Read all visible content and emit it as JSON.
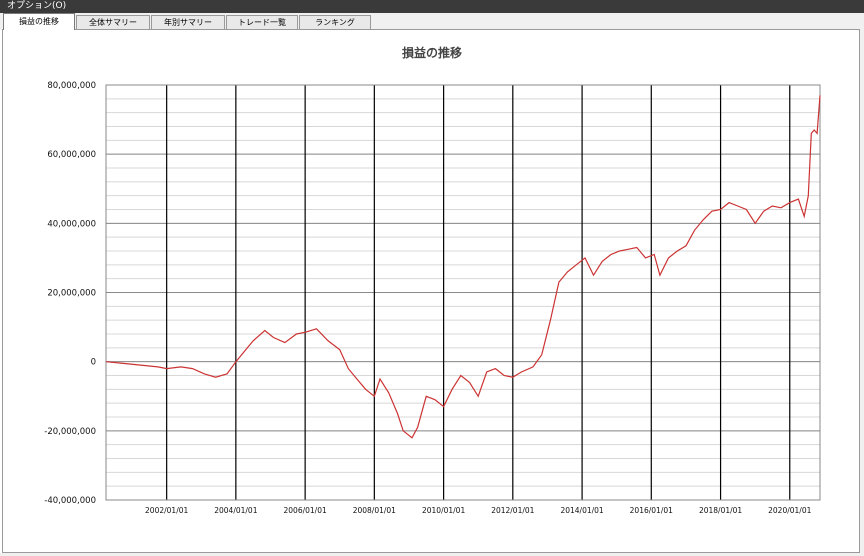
{
  "menu": {
    "options_label": "オプション(O)"
  },
  "tabs": [
    {
      "label": "損益の推移",
      "active": true
    },
    {
      "label": "全体サマリー",
      "active": false
    },
    {
      "label": "年別サマリー",
      "active": false
    },
    {
      "label": "トレード一覧",
      "active": false
    },
    {
      "label": "ランキング",
      "active": false
    }
  ],
  "chart_data": {
    "type": "line",
    "title": "損益の推移",
    "xlabel": "",
    "ylabel": "",
    "ylim": [
      -40000000,
      80000000
    ],
    "xlim": [
      "2000-04-01",
      "2020-11-15"
    ],
    "y_ticks": [
      -40000000,
      -20000000,
      0,
      20000000,
      40000000,
      60000000,
      80000000
    ],
    "y_tick_labels": [
      "-40,000,000",
      "-20,000,000",
      "0",
      "20,000,000",
      "40,000,000",
      "60,000,000",
      "80,000,000"
    ],
    "x_tick_dates": [
      "2002-01-01",
      "2004-01-01",
      "2006-01-01",
      "2008-01-01",
      "2010-01-01",
      "2012-01-01",
      "2014-01-01",
      "2016-01-01",
      "2018-01-01",
      "2020-01-01"
    ],
    "x_tick_labels": [
      "2002/01/01",
      "2004/01/01",
      "2006/01/01",
      "2008/01/01",
      "2010/01/01",
      "2012/01/01",
      "2014/01/01",
      "2016/01/01",
      "2018/01/01",
      "2020/01/01"
    ],
    "grid": true,
    "line_color": "#cc3333",
    "series": [
      {
        "x": [
          "2000-04-01",
          "2000-10-01",
          "2001-04-01",
          "2001-10-01",
          "2002-01-01",
          "2002-06-01",
          "2002-10-01",
          "2003-02-01",
          "2003-06-01",
          "2003-10-01",
          "2004-01-01",
          "2004-04-01",
          "2004-07-01",
          "2004-11-01",
          "2005-02-01",
          "2005-06-01",
          "2005-10-01",
          "2006-01-01",
          "2006-05-01",
          "2006-09-01",
          "2007-01-01",
          "2007-04-01",
          "2007-07-01",
          "2007-10-01",
          "2008-01-01",
          "2008-03-01",
          "2008-06-01",
          "2008-09-01",
          "2008-11-01",
          "2009-02-01",
          "2009-04-01",
          "2009-07-01",
          "2009-10-01",
          "2010-01-01",
          "2010-04-01",
          "2010-07-01",
          "2010-10-01",
          "2011-01-01",
          "2011-04-01",
          "2011-07-01",
          "2011-10-01",
          "2012-01-01",
          "2012-04-01",
          "2012-08-01",
          "2012-11-01",
          "2013-02-01",
          "2013-05-01",
          "2013-08-01",
          "2013-11-01",
          "2014-02-01",
          "2014-05-01",
          "2014-08-01",
          "2014-11-01",
          "2015-02-01",
          "2015-05-01",
          "2015-08-01",
          "2015-11-01",
          "2016-02-01",
          "2016-04-01",
          "2016-07-01",
          "2016-10-01",
          "2017-01-01",
          "2017-04-01",
          "2017-07-01",
          "2017-10-01",
          "2018-01-01",
          "2018-04-01",
          "2018-07-01",
          "2018-10-01",
          "2019-01-01",
          "2019-04-01",
          "2019-07-01",
          "2019-10-01",
          "2020-01-01",
          "2020-04-01",
          "2020-06-01",
          "2020-07-15",
          "2020-08-15",
          "2020-09-15",
          "2020-10-15",
          "2020-11-15"
        ],
        "values": [
          0,
          -500000,
          -1000000,
          -1500000,
          -2000000,
          -1500000,
          -2000000,
          -3500000,
          -4500000,
          -3500000,
          0,
          3000000,
          6000000,
          9000000,
          7000000,
          5500000,
          8000000,
          8500000,
          9500000,
          6000000,
          3500000,
          -2000000,
          -5000000,
          -8000000,
          -10000000,
          -5000000,
          -9000000,
          -15000000,
          -20000000,
          -22000000,
          -19000000,
          -10000000,
          -11000000,
          -13000000,
          -8000000,
          -4000000,
          -6000000,
          -10000000,
          -3000000,
          -2000000,
          -4000000,
          -4500000,
          -3000000,
          -1500000,
          2000000,
          12000000,
          23000000,
          26000000,
          28000000,
          30000000,
          25000000,
          29000000,
          31000000,
          32000000,
          32500000,
          33000000,
          30000000,
          31000000,
          25000000,
          30000000,
          32000000,
          33500000,
          38000000,
          41000000,
          43500000,
          44000000,
          46000000,
          45000000,
          44000000,
          40000000,
          43500000,
          45000000,
          44500000,
          46000000,
          47000000,
          42000000,
          48000000,
          66000000,
          67000000,
          66000000,
          77000000
        ]
      }
    ]
  }
}
